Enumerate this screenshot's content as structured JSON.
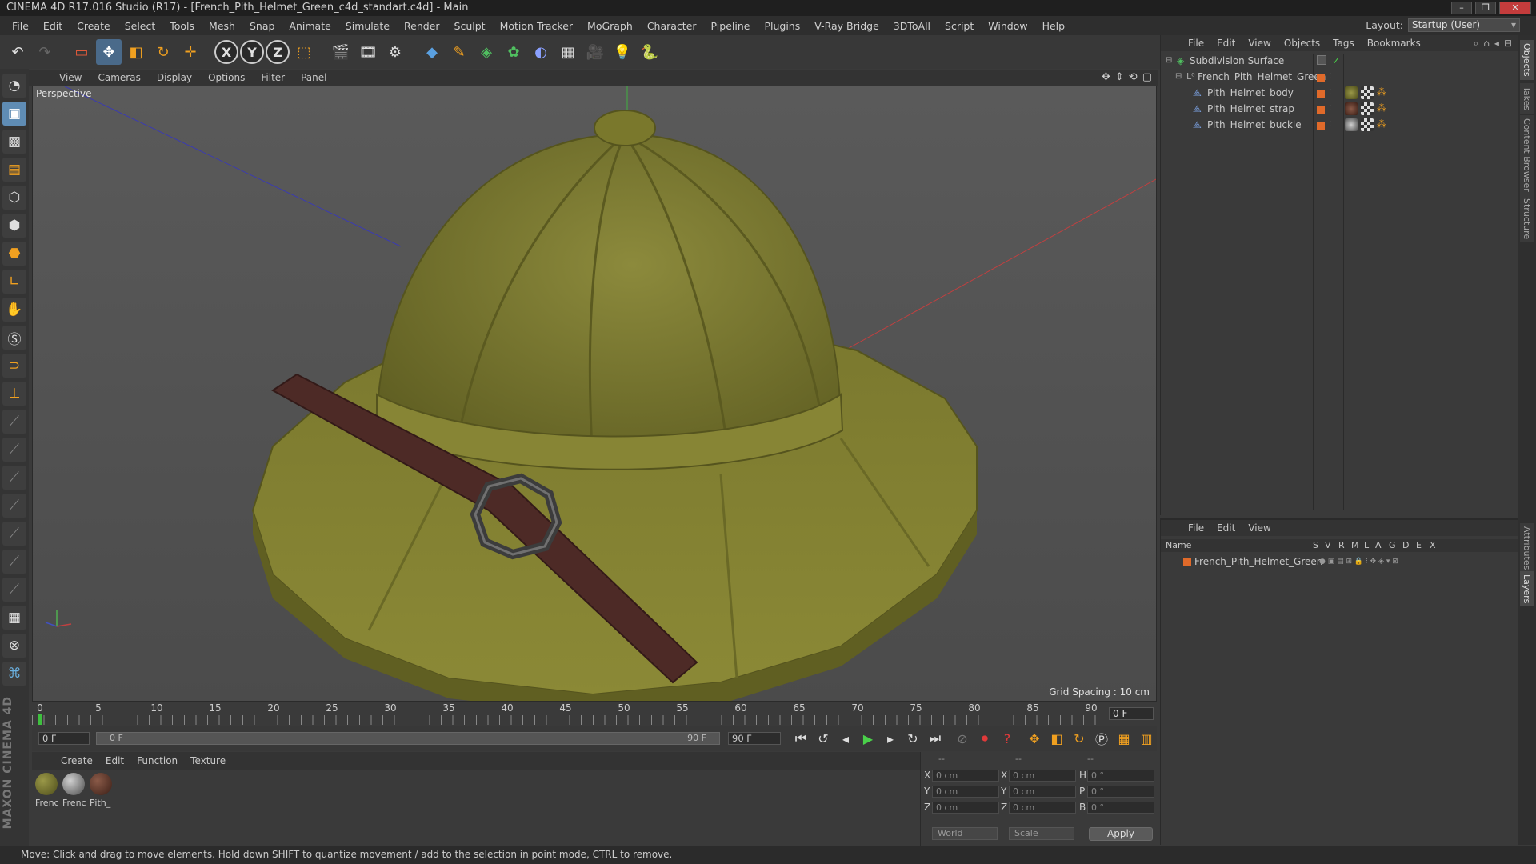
{
  "window": {
    "title": "CINEMA 4D R17.016 Studio (R17) - [French_Pith_Helmet_Green_c4d_standart.c4d] - Main"
  },
  "menubar": {
    "items": [
      "File",
      "Edit",
      "Create",
      "Select",
      "Tools",
      "Mesh",
      "Snap",
      "Animate",
      "Simulate",
      "Render",
      "Sculpt",
      "Motion Tracker",
      "MoGraph",
      "Character",
      "Pipeline",
      "Plugins",
      "V-Ray Bridge",
      "3DToAll",
      "Script",
      "Window",
      "Help"
    ],
    "layout_label": "Layout:",
    "layout_value": "Startup (User)"
  },
  "toolbar": {
    "axis_x": "X",
    "axis_y": "Y",
    "axis_z": "Z"
  },
  "viewport": {
    "menu": [
      "View",
      "Cameras",
      "Display",
      "Options",
      "Filter",
      "Panel"
    ],
    "label": "Perspective",
    "grid_spacing": "Grid Spacing : 10 cm"
  },
  "timeline": {
    "ticks": [
      "0",
      "5",
      "10",
      "15",
      "20",
      "25",
      "30",
      "35",
      "40",
      "45",
      "50",
      "55",
      "60",
      "65",
      "70",
      "75",
      "80",
      "85",
      "90"
    ],
    "current_frame": "0 F"
  },
  "transport": {
    "start_field": "0 F",
    "range_start": "0 F",
    "range_end": "90 F",
    "end_field": "90 F"
  },
  "materials": {
    "menu": [
      "Create",
      "Edit",
      "Function",
      "Texture"
    ],
    "items": [
      {
        "label": "Frenc",
        "color": "#6b6a2a"
      },
      {
        "label": "Frenc",
        "color": "#8a8a8a"
      },
      {
        "label": "Pith_",
        "color": "#5a2e20"
      }
    ]
  },
  "coords": {
    "headers": [
      "--",
      "--",
      "--"
    ],
    "rows": [
      {
        "a": "X",
        "av": "0 cm",
        "b": "X",
        "bv": "0 cm",
        "c": "H",
        "cv": "0 °"
      },
      {
        "a": "Y",
        "av": "0 cm",
        "b": "Y",
        "bv": "0 cm",
        "c": "P",
        "cv": "0 °"
      },
      {
        "a": "Z",
        "av": "0 cm",
        "b": "Z",
        "bv": "0 cm",
        "c": "B",
        "cv": "0 °"
      }
    ],
    "space": "World",
    "mode": "Scale",
    "apply": "Apply"
  },
  "objects": {
    "menu": [
      "File",
      "Edit",
      "View",
      "Objects",
      "Tags",
      "Bookmarks"
    ],
    "items": [
      {
        "name": "Subdivision Surface",
        "indent": 0
      },
      {
        "name": "French_Pith_Helmet_Green",
        "indent": 1
      },
      {
        "name": "Pith_Helmet_body",
        "indent": 2
      },
      {
        "name": "Pith_Helmet_strap",
        "indent": 2
      },
      {
        "name": "Pith_Helmet_buckle",
        "indent": 2
      }
    ]
  },
  "layers": {
    "menu": [
      "File",
      "Edit",
      "View"
    ],
    "columns": [
      "Name",
      "S",
      "V",
      "R",
      "M",
      "L",
      "A",
      "G",
      "D",
      "E",
      "X"
    ],
    "rows": [
      {
        "name": "French_Pith_Helmet_Green",
        "color": "#e06a2a"
      }
    ]
  },
  "sidetabs": [
    "Objects",
    "Takes",
    "Content Browser",
    "Structure",
    "Attributes",
    "Layers"
  ],
  "status": {
    "text": "Move: Click and drag to move elements. Hold down SHIFT to quantize movement / add to the selection in point mode, CTRL to remove."
  }
}
